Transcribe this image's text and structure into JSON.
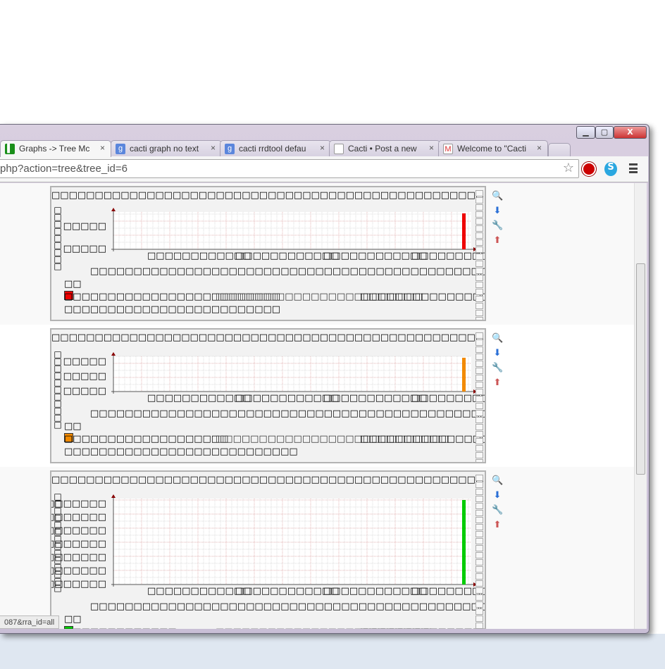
{
  "window": {
    "min": "▁",
    "max": "▢",
    "close": "X"
  },
  "tabs": [
    {
      "label": "Graphs -> Tree Mc",
      "icon": "cacti-icon",
      "color": "#1a8f1a",
      "glyph": "▌",
      "active": true
    },
    {
      "label": "cacti graph no text",
      "icon": "google-icon",
      "color": "#5b86dc",
      "glyph": "g"
    },
    {
      "label": "cacti rrdtool defau",
      "icon": "google-icon",
      "color": "#5b86dc",
      "glyph": "g"
    },
    {
      "label": "Cacti • Post a new",
      "icon": "page-icon",
      "color": "#ffffff",
      "glyph": ""
    },
    {
      "label": "Welcome to \"Cacti",
      "icon": "gmail-icon",
      "color": "#ffffff",
      "glyph": "M"
    }
  ],
  "close_glyph": "×",
  "address": {
    "url": "php?action=tree&tree_id=6",
    "star": "☆"
  },
  "status_text": "087&rra_id=all",
  "graphs": [
    {
      "title": "□□□□□□□□□□□□□□□□□□□□□□□□□□□□□□□□□□□□□□□□□□□□□□□□□□□□□",
      "ylabel": "□□□□□□□□□",
      "yticks": [
        "□□□□□",
        "□□□□□"
      ],
      "xticks": [
        "□□□□□□□□□□□□",
        "□□□□□□□□□□□□",
        "□□□□□□□□□□□□",
        "□□□□□□□□□□□□"
      ],
      "comment": "□□□□□□□□□□□□□□□□□□□□□□□□□□□□□□□□□□□□□□□□□□□□□□□□□□□□□□□□□□□□□□□□□□□□□□",
      "legend_head": "□□",
      "color": "#ee0000",
      "legend": [
        "□□□□□□□□□□□□□□□□□□□□□□□□□",
        "□□□□□□□□□□□□□□□□□□□□□□□□",
        "□□□□□□□□□□□□□□□□□□□□□□□□"
      ],
      "legend2": "□□□□□□□□□□□□□□□□□□□□□□□□□"
    },
    {
      "title": "□□□□□□□□□□□□□□□□□□□□□□□□□□□□□□□□□□□□□□□□□□□□□□□□□□□□□□□□□□□□□□□",
      "ylabel": "□□□□□□□□□□□",
      "yticks": [
        "□□□□□",
        "□□□□□",
        "□□□□□"
      ],
      "xticks": [
        "□□□□□□□□□□□□",
        "□□□□□□□□□□□□",
        "□□□□□□□□□□□□",
        "□□□□□□□□□□□□"
      ],
      "comment": "□□□□□□□□□□□□□□□□□□□□□□□□□□□□□□□□□□□□□□□□□□□□□□□□□□□□□□□□□□□□□□□□□□□□□□",
      "legend_head": "□□",
      "color": "#f28a00",
      "legend": [
        "□□□□□□□□□□□□□□□□□□□",
        "□□□□□□□□□□□□□□□□□□□□□□□□□□□",
        "□□□□□□□□□□□□□□□□□□□□□□□□□□□"
      ],
      "legend2": "□□□□□□□□□□□□□□□□□□□□□□□□□□□"
    },
    {
      "title": "□□□□□□□□□□□□□□□□□□□□□□□□□□□□□□□□□□□□□□□□□□□□□□□□□□□□□□□□",
      "ylabel": "□□□□□□□□□□□□□□",
      "yticks": [
        "□□□□□□□",
        "□□□□□□□",
        "□□□□□□□",
        "□□□□□□□",
        "□□□□□□□",
        "□□□□□□□",
        "□□□□□□□"
      ],
      "xticks": [
        "□□□□□□□□□□□□",
        "□□□□□□□□□□□□",
        "□□□□□□□□□□□□",
        "□□□□□□□□□□□□"
      ],
      "comment": "□□□□□□□□□□□□□□□□□□□□□□□□□□□□□□□□□□□□□□□□□□□□□□□□□□□□□□□□□□□□□□□□□□□□□□",
      "legend_head": "□□",
      "color": "#00cc00",
      "legend": [
        "□□□□□□□□□□□□□",
        "□□□□□□□□□□□□□□□□□□□□□□□□□",
        "□□□□□□□□□□□□□□□□□□□□□□□□□□"
      ],
      "legend2": ""
    }
  ],
  "actions": [
    {
      "name": "zoom-icon",
      "glyph": "🔍"
    },
    {
      "name": "download-icon",
      "glyph": "⬇"
    },
    {
      "name": "edit-wrench-icon",
      "glyph": "🔧"
    },
    {
      "name": "top-arrow-icon",
      "glyph": "⬆"
    }
  ]
}
